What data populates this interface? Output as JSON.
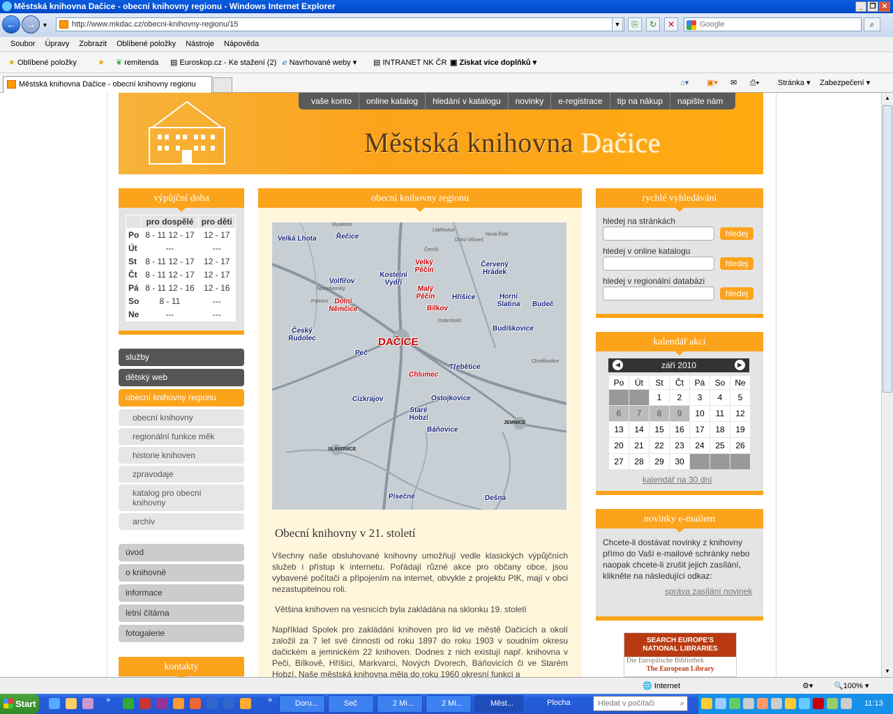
{
  "browser": {
    "title": "Městská knihovna Dačice - obecní knihovny regionu - Windows Internet Explorer",
    "url": "http://www.mkdac.cz/obecni-knihovny-regionu/15",
    "search_placeholder": "Google",
    "menu": [
      "Soubor",
      "Úpravy",
      "Zobrazit",
      "Oblíbené položky",
      "Nástroje",
      "Nápověda"
    ],
    "favorites_label": "Oblíbené položky",
    "favorites": [
      "remitenda",
      "Euroskop.cz - Ke stažení (2)",
      "Navrhované weby",
      "INTRANET NK ČR",
      "Získat více doplňků"
    ],
    "tab_title": "Městská knihovna Dačice - obecní knihovny regionu",
    "cmd": [
      "Stránka",
      "Zabezpečení"
    ],
    "status_zone": "Internet",
    "zoom": "100%"
  },
  "site": {
    "title_part1": "Městská knihovna",
    "title_part2": "Dačice",
    "topnav": [
      "vaše konto",
      "online katalog",
      "hledání v katalogu",
      "novinky",
      "e-registrace",
      "tip na nákup",
      "napište nám"
    ]
  },
  "hours": {
    "heading": "výpůjční doba",
    "col1": "pro dospělé",
    "col2": "pro děti",
    "rows": [
      {
        "d": "Po",
        "a": "8 - 11 12 - 17",
        "c": "12 - 17"
      },
      {
        "d": "Út",
        "a": "---",
        "c": "---"
      },
      {
        "d": "St",
        "a": "8 - 11 12 - 17",
        "c": "12 - 17"
      },
      {
        "d": "Čt",
        "a": "8 - 11 12 - 17",
        "c": "12 - 17"
      },
      {
        "d": "Pá",
        "a": "8 - 11 12 - 16",
        "c": "12 - 16"
      },
      {
        "d": "So",
        "a": "8 - 11",
        "c": "---"
      },
      {
        "d": "Ne",
        "a": "---",
        "c": "---"
      }
    ]
  },
  "leftnav": {
    "sluzby": "služby",
    "detsky": "dětský web",
    "obecni": "obecní knihovny regionu",
    "sub": [
      "obecní knihovny",
      "regionální funkce měk",
      "historie knihoven",
      "zpravodaje",
      "katalog pro obecní knihovny",
      "archiv"
    ],
    "bottom": [
      "úvod",
      "o knihovně",
      "informace",
      "letní čítárna",
      "fotogalerie"
    ],
    "kontakty": "kontakty"
  },
  "main": {
    "heading": "obecní knihovny regionu",
    "article_title": "Obecní knihovny v 21. století",
    "p1": "Všechny naše obsluhované knihovny umožňují vedle klasických výpůjčních služeb i přístup k internetu. Pořádají různé akce pro občany obce, jsou vybavené počítači a připojením na internet, obvykle z projektu PIK, mají v obci nezastupitelnou roli.",
    "p2": "Většina knihoven na vesnicích byla zakládána na sklonku 19. století",
    "p3": "Například Spolek pro zakládání knihoven pro lid ve městě Dačicích a okolí založil za 7 let své činnosti od roku 1897 do roku 1903 v soudním okresu dačickém a jemnickém 22 knihoven. Dodnes z nich existují např. knihovna v Peči, Bílkově, Hříšici, Markvarci, Nových Dvorech, Báňovicích či ve Starém Hobzí. Naše městská knihovna měla do roku 1960 okresní funkci a"
  },
  "map": {
    "places": [
      "Velká Lhota",
      "Řečice",
      "Kostelní Vydří",
      "Velký Pěčín",
      "Červený Hrádek",
      "Volfířov",
      "Malý Pěčín",
      "Dolní Němčice",
      "Hříšice",
      "Horní Slatina",
      "Bílkov",
      "Budeč",
      "Český Rudolec",
      "DAČICE",
      "Budíškovice",
      "Peč",
      "Třebětice",
      "Chlumec",
      "Cizkrajov",
      "Ostojkovice",
      "Staré Hobzí",
      "Báňovice",
      "Písečné",
      "Dešná"
    ],
    "small": [
      "Mysletice",
      "Lidéřovice",
      "Dolní Vilímeč",
      "Nová Říše",
      "Černíč",
      "Novodvorský",
      "Pařezní",
      "Dobrohošť",
      "SLAVONICE",
      "JEMNICE",
      "Chotěbudice"
    ]
  },
  "search": {
    "heading": "rychlé vyhledávání",
    "l1": "hledej na stránkách",
    "l2": "hledej v online katalogu",
    "l3": "hledej v regionální databázi",
    "btn": "hledej"
  },
  "calendar": {
    "heading": "kalendář akcí",
    "month": "září 2010",
    "days": [
      "Po",
      "Út",
      "St",
      "Čt",
      "Pá",
      "So",
      "Ne"
    ],
    "link": "kalendář na 30 dní"
  },
  "newsletter": {
    "heading": "novinky e-mailem",
    "text": "Chcete-li dostávat novinky z knihovny přímo do Vaší e-mailové schránky nebo naopak chcete-li zrušit jejich zasílání, klikněte na následující odkaz:",
    "link": "správa zasílání novinek"
  },
  "europe_banner": {
    "l1": "SEARCH EUROPE'S",
    "l2": "NATIONAL LIBRARIES",
    "l3": "Die Europäische Bibliothek",
    "l4": "The European Library"
  },
  "taskbar": {
    "start": "Start",
    "items": [
      "Doru...",
      "Seč",
      "2 Mi...",
      "2 Mi...",
      "Měst...",
      "Plocha"
    ],
    "search_placeholder": "Hledat v počítači",
    "clock": "11:13"
  },
  "colors": {
    "accent": "#fca31c",
    "dark": "#555555"
  }
}
